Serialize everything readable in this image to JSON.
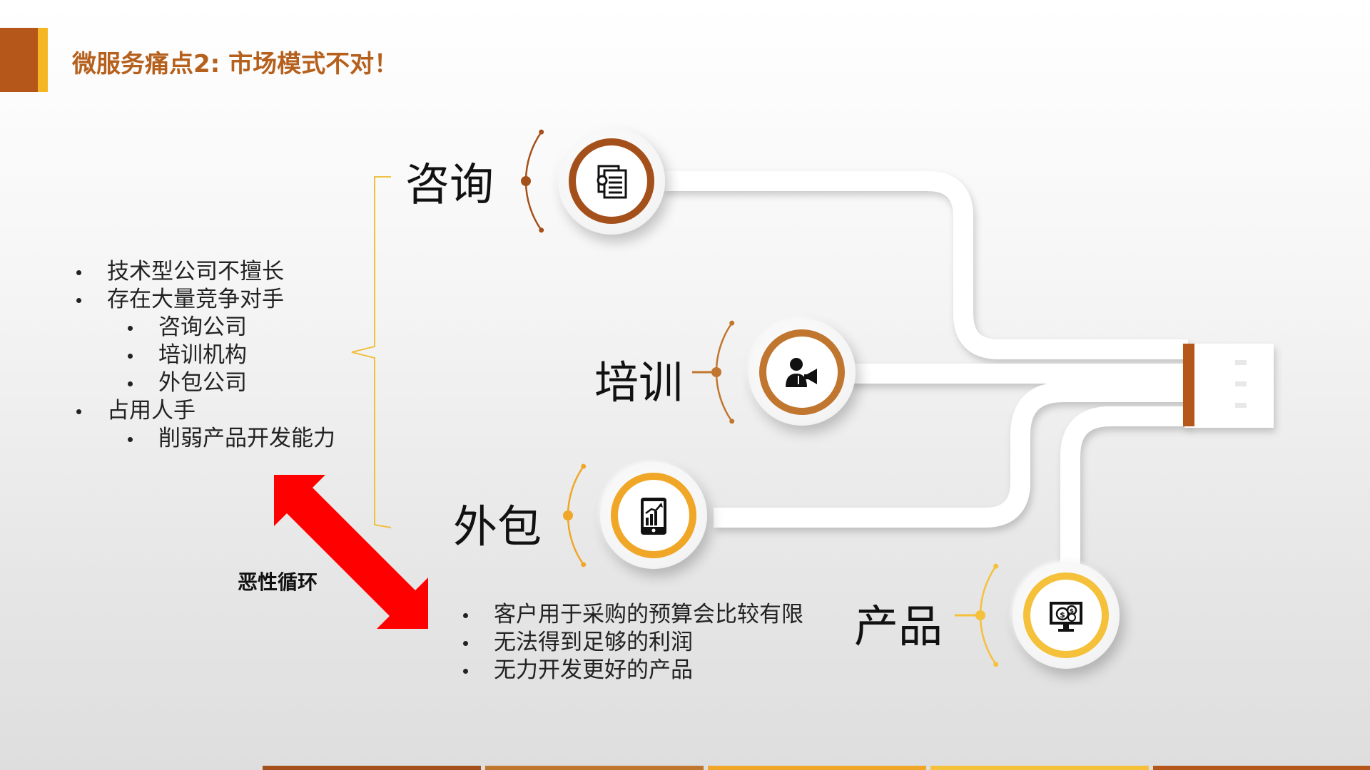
{
  "slide": {
    "title": "微服务痛点2: 市场模式不对！"
  },
  "left_list": [
    {
      "level": 1,
      "text": "技术型公司不擅长"
    },
    {
      "level": 1,
      "text": "存在大量竞争对手"
    },
    {
      "level": 2,
      "text": "咨询公司"
    },
    {
      "level": 2,
      "text": "培训机构"
    },
    {
      "level": 2,
      "text": "外包公司"
    },
    {
      "level": 1,
      "text": "占用人手"
    },
    {
      "level": 2,
      "text": "削弱产品开发能力"
    }
  ],
  "cycle_label": "恶性循环",
  "bottom_list": [
    "客户用于采购的预算会比较有限",
    "无法得到足够的利润",
    "无力开发更好的产品"
  ],
  "nodes": [
    {
      "label": "咨询",
      "icon": "document-icon",
      "color": "#a4501b"
    },
    {
      "label": "培训",
      "icon": "presenter-icon",
      "color": "#c0762e"
    },
    {
      "label": "外包",
      "icon": "mobile-chart-icon",
      "color": "#f0a626"
    },
    {
      "label": "产品",
      "icon": "money-monitor-icon",
      "color": "#f5c03a"
    }
  ],
  "colors": {
    "title": "#b5601c",
    "accent_dark": "#b5571a",
    "accent_yellow": "#f5b623",
    "brace": "#f0c040",
    "arrow": "#ff0000"
  },
  "footer_colors": [
    "#a4501b",
    "#c0762e",
    "#f0a626",
    "#f5c03a",
    "#b5571a"
  ]
}
